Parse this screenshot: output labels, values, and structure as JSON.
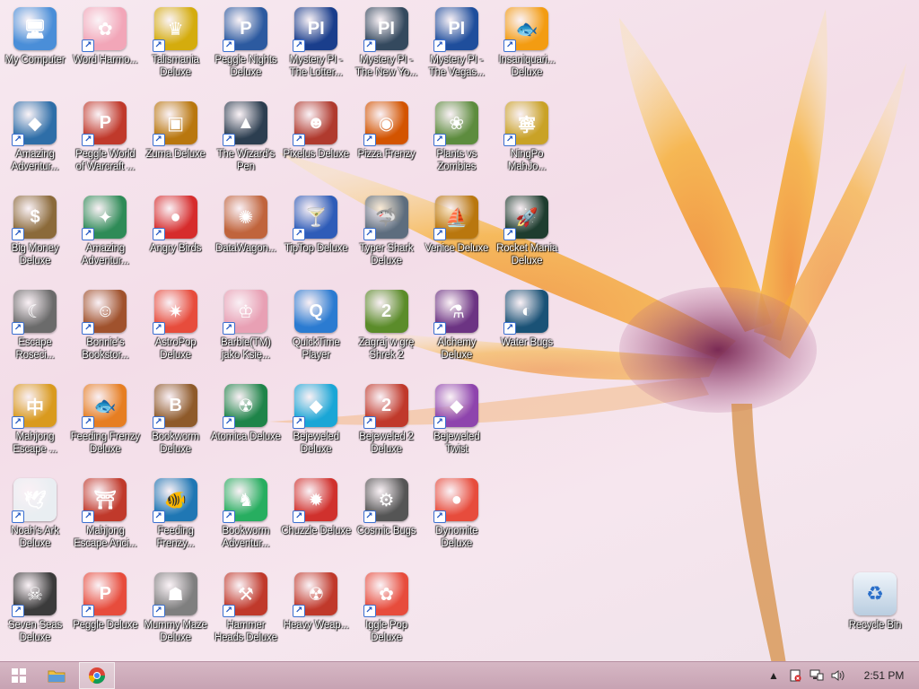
{
  "desktop": {
    "icons": [
      {
        "label": "My Computer",
        "color": "#4a8ed8",
        "glyph": "🖥",
        "shortcut": false
      },
      {
        "label": "Amazing Adventur...",
        "color": "#2e6ea8",
        "glyph": "◆",
        "shortcut": true
      },
      {
        "label": "Big Money Deluxe",
        "color": "#8b6a3a",
        "glyph": "$",
        "shortcut": true
      },
      {
        "label": "Escape Roseci...",
        "color": "#6b6b6b",
        "glyph": "☾",
        "shortcut": true
      },
      {
        "label": "Mahjong Escape ...",
        "color": "#d99a1e",
        "glyph": "中",
        "shortcut": true
      },
      {
        "label": "Noah's Ark Deluxe",
        "color": "#e9eef2",
        "glyph": "🕊",
        "shortcut": true
      },
      {
        "label": "Seven Seas Deluxe",
        "color": "#3b3b3b",
        "glyph": "☠",
        "shortcut": true
      },
      {
        "label": "Word Harmo...",
        "color": "#f2a6b8",
        "glyph": "✿",
        "shortcut": true
      },
      {
        "label": "Peggle World of Warcraft ...",
        "color": "#c0392b",
        "glyph": "P",
        "shortcut": true
      },
      {
        "label": "Amazing Adventur...",
        "color": "#2e8b57",
        "glyph": "✦",
        "shortcut": true
      },
      {
        "label": "Bonnie's Bookstor...",
        "color": "#a0522d",
        "glyph": "☺",
        "shortcut": true
      },
      {
        "label": "Feeding Frenzy Deluxe",
        "color": "#e67e22",
        "glyph": "🐟",
        "shortcut": true
      },
      {
        "label": "Mahjong Escape Anci...",
        "color": "#c0392b",
        "glyph": "⛩",
        "shortcut": true
      },
      {
        "label": "Peggle Deluxe",
        "color": "#e74c3c",
        "glyph": "P",
        "shortcut": true
      },
      {
        "label": "Talismania Deluxe",
        "color": "#d4ac0d",
        "glyph": "♛",
        "shortcut": true
      },
      {
        "label": "Zuma Deluxe",
        "color": "#b9770e",
        "glyph": "▣",
        "shortcut": true
      },
      {
        "label": "Angry Birds",
        "color": "#d62c2c",
        "glyph": "●",
        "shortcut": true
      },
      {
        "label": "AstroPop Deluxe",
        "color": "#e74c3c",
        "glyph": "✷",
        "shortcut": true
      },
      {
        "label": "Bookworm Deluxe",
        "color": "#8e5a2a",
        "glyph": "B",
        "shortcut": true
      },
      {
        "label": "Feeding Frenzy...",
        "color": "#1f77b4",
        "glyph": "🐠",
        "shortcut": true
      },
      {
        "label": "Mummy Maze Deluxe",
        "color": "#7f7f7f",
        "glyph": "☗",
        "shortcut": true
      },
      {
        "label": "Peggle Nights Deluxe",
        "color": "#2c5aa0",
        "glyph": "P",
        "shortcut": true
      },
      {
        "label": "The Wizard's Pen",
        "color": "#2c3e50",
        "glyph": "▲",
        "shortcut": true
      },
      {
        "label": "DataWagon...",
        "color": "#c0643c",
        "glyph": "✺",
        "shortcut": false
      },
      {
        "label": "Barbie(TM) jako Księ...",
        "color": "#e8a0b4",
        "glyph": "♔",
        "shortcut": true
      },
      {
        "label": "Atomica Deluxe",
        "color": "#1e8449",
        "glyph": "☢",
        "shortcut": true
      },
      {
        "label": "Bookworm Adventur...",
        "color": "#27ae60",
        "glyph": "♞",
        "shortcut": true
      },
      {
        "label": "Hammer Heads Deluxe",
        "color": "#c0392b",
        "glyph": "⚒",
        "shortcut": true
      },
      {
        "label": "Mystery PI - The Lotter...",
        "color": "#1a3e8c",
        "glyph": "PI",
        "shortcut": true
      },
      {
        "label": "Pixelus Deluxe",
        "color": "#b03a2e",
        "glyph": "☻",
        "shortcut": true
      },
      {
        "label": "TipTop Deluxe",
        "color": "#2e5cb8",
        "glyph": "🍸",
        "shortcut": true
      },
      {
        "label": "QuickTime Player",
        "color": "#2b7bd1",
        "glyph": "Q",
        "shortcut": false
      },
      {
        "label": "Bejeweled Deluxe",
        "color": "#1aa6d6",
        "glyph": "◆",
        "shortcut": true
      },
      {
        "label": "Chuzzle Deluxe",
        "color": "#d0312d",
        "glyph": "✹",
        "shortcut": true
      },
      {
        "label": "Heavy Weap...",
        "color": "#c0392b",
        "glyph": "☢",
        "shortcut": true
      },
      {
        "label": "Mystery PI - The New Yo...",
        "color": "#34495e",
        "glyph": "PI",
        "shortcut": true
      },
      {
        "label": "Pizza Frenzy",
        "color": "#d35400",
        "glyph": "◉",
        "shortcut": true
      },
      {
        "label": "Typer Shark Deluxe",
        "color": "#5d6d7e",
        "glyph": "🦈",
        "shortcut": true
      },
      {
        "label": "Zagraj w grę Shrek 2",
        "color": "#5b8c2a",
        "glyph": "2",
        "shortcut": false
      },
      {
        "label": "Bejeweled 2 Deluxe",
        "color": "#c0392b",
        "glyph": "2",
        "shortcut": true
      },
      {
        "label": "Cosmic Bugs",
        "color": "#555555",
        "glyph": "⚙",
        "shortcut": true
      },
      {
        "label": "Iggle Pop Deluxe",
        "color": "#e74c3c",
        "glyph": "✿",
        "shortcut": true
      },
      {
        "label": "Mystery PI - The Vegas...",
        "color": "#1f4e9c",
        "glyph": "PI",
        "shortcut": true
      },
      {
        "label": "Plants vs Zombies",
        "color": "#5d8c3e",
        "glyph": "❀",
        "shortcut": true
      },
      {
        "label": "Venice Deluxe",
        "color": "#b9770e",
        "glyph": "⛵",
        "shortcut": true
      },
      {
        "label": "Alchemy Deluxe",
        "color": "#6c3483",
        "glyph": "⚗",
        "shortcut": true
      },
      {
        "label": "Bejeweled Twist",
        "color": "#8e44ad",
        "glyph": "◆",
        "shortcut": true
      },
      {
        "label": "Dynomite Deluxe",
        "color": "#e74c3c",
        "glyph": "●",
        "shortcut": true
      },
      {
        "label": "Insaniquari... Deluxe",
        "color": "#f39c12",
        "glyph": "🐟",
        "shortcut": true
      },
      {
        "label": "NingPo MahJo...",
        "color": "#c9a227",
        "glyph": "寧",
        "shortcut": true
      },
      {
        "label": "Rocket Mania Deluxe",
        "color": "#1e3d2f",
        "glyph": "🚀",
        "shortcut": true
      },
      {
        "label": "Water Bugs",
        "color": "#1a5276",
        "glyph": "◐",
        "shortcut": true
      }
    ],
    "recycle_bin": {
      "label": "Recycle Bin"
    }
  },
  "taskbar": {
    "start": "start-button",
    "pinned": [
      {
        "name": "file-explorer",
        "color": "#f0c040"
      },
      {
        "name": "chrome",
        "color": "#4285f4"
      }
    ],
    "tray": {
      "clock": "2:51 PM"
    }
  }
}
